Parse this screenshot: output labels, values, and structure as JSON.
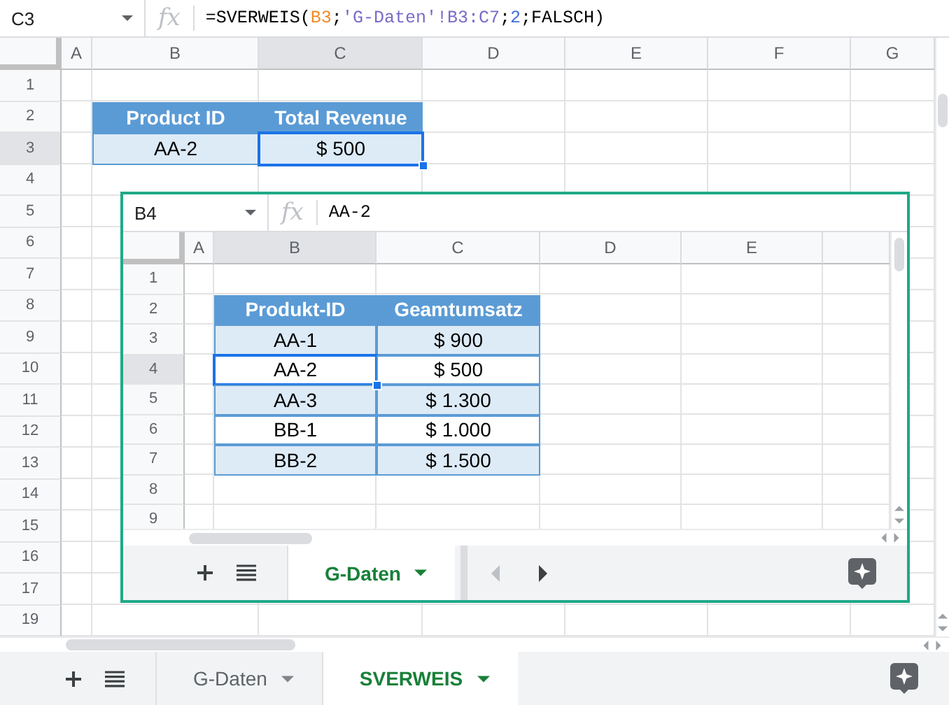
{
  "name_box": "C3",
  "fx_label": "fx",
  "formula": [
    {
      "text": "=SVERWEIS(",
      "color": "#000000"
    },
    {
      "text": "B3",
      "color": "#f28b2a"
    },
    {
      "text": ";",
      "color": "#000000"
    },
    {
      "text": "'G-Daten'!B3:C7",
      "color": "#7b6bc9"
    },
    {
      "text": ";",
      "color": "#000000"
    },
    {
      "text": "2",
      "color": "#3f6fd8"
    },
    {
      "text": ";FALSCH)",
      "color": "#000000"
    }
  ],
  "columns": [
    {
      "label": "A",
      "selected": false
    },
    {
      "label": "B",
      "selected": false
    },
    {
      "label": "C",
      "selected": true
    },
    {
      "label": "D",
      "selected": false
    },
    {
      "label": "E",
      "selected": false
    },
    {
      "label": "F",
      "selected": false
    },
    {
      "label": "G",
      "selected": false
    }
  ],
  "rows": [
    {
      "label": "1",
      "selected": false,
      "cells": []
    },
    {
      "label": "2",
      "selected": false,
      "cells": [
        {
          "text": "",
          "kind": "blank"
        },
        {
          "text": "Product ID",
          "kind": "header",
          "active": false
        },
        {
          "text": "Total Revenue",
          "kind": "header",
          "active": false
        }
      ]
    },
    {
      "label": "3",
      "selected": true,
      "cells": [
        {
          "text": "",
          "kind": "blank"
        },
        {
          "text": "AA-2",
          "kind": "data",
          "banded": true,
          "active": false
        },
        {
          "text": "$ 500",
          "kind": "data",
          "banded": true,
          "active": true
        }
      ]
    },
    {
      "label": "4",
      "selected": false,
      "cells": []
    },
    {
      "label": "5",
      "selected": false,
      "cells": []
    },
    {
      "label": "6",
      "selected": false,
      "cells": []
    },
    {
      "label": "7",
      "selected": false,
      "cells": []
    },
    {
      "label": "8",
      "selected": false,
      "cells": []
    },
    {
      "label": "9",
      "selected": false,
      "cells": []
    },
    {
      "label": "10",
      "selected": false,
      "cells": []
    },
    {
      "label": "11",
      "selected": false,
      "cells": []
    },
    {
      "label": "12",
      "selected": false,
      "cells": []
    },
    {
      "label": "13",
      "selected": false,
      "cells": []
    },
    {
      "label": "14",
      "selected": false,
      "cells": []
    },
    {
      "label": "15",
      "selected": false,
      "cells": []
    },
    {
      "label": "16",
      "selected": false,
      "cells": []
    },
    {
      "label": "17",
      "selected": false,
      "cells": []
    },
    {
      "label": "19",
      "selected": false,
      "cells": []
    }
  ],
  "sheet_tabs": [
    {
      "label": "G-Daten",
      "selected": false
    },
    {
      "label": "SVERWEIS",
      "selected": true
    }
  ],
  "embedded_screenshot": {
    "name_box": "B4",
    "fx_label": "fx",
    "formula": [
      {
        "text": "AA-2",
        "color": "#000000"
      }
    ],
    "columns": [
      {
        "label": "A",
        "selected": false
      },
      {
        "label": "B",
        "selected": true
      },
      {
        "label": "C",
        "selected": false
      },
      {
        "label": "D",
        "selected": false
      },
      {
        "label": "E",
        "selected": false
      }
    ],
    "rows": [
      {
        "label": "1",
        "selected": false,
        "cells": []
      },
      {
        "label": "2",
        "selected": false,
        "cells": [
          {
            "text": "",
            "kind": "blank"
          },
          {
            "text": "Produkt-ID",
            "kind": "header",
            "active": false
          },
          {
            "text": "Geamtumsatz",
            "kind": "header",
            "active": false
          }
        ]
      },
      {
        "label": "3",
        "selected": false,
        "cells": [
          {
            "text": "",
            "kind": "blank"
          },
          {
            "text": "AA-1",
            "kind": "data",
            "banded": true,
            "active": false
          },
          {
            "text": "$ 900",
            "kind": "data",
            "banded": true,
            "active": false
          }
        ]
      },
      {
        "label": "4",
        "selected": true,
        "cells": [
          {
            "text": "",
            "kind": "blank"
          },
          {
            "text": "AA-2",
            "kind": "data",
            "banded": false,
            "active": true
          },
          {
            "text": "$ 500",
            "kind": "data",
            "banded": false,
            "active": false
          }
        ]
      },
      {
        "label": "5",
        "selected": false,
        "cells": [
          {
            "text": "",
            "kind": "blank"
          },
          {
            "text": "AA-3",
            "kind": "data",
            "banded": true,
            "active": false
          },
          {
            "text": "$ 1.300",
            "kind": "data",
            "banded": true,
            "active": false
          }
        ]
      },
      {
        "label": "6",
        "selected": false,
        "cells": [
          {
            "text": "",
            "kind": "blank"
          },
          {
            "text": "BB-1",
            "kind": "data",
            "banded": false,
            "active": false
          },
          {
            "text": "$ 1.000",
            "kind": "data",
            "banded": false,
            "active": false
          }
        ]
      },
      {
        "label": "7",
        "selected": false,
        "cells": [
          {
            "text": "",
            "kind": "blank"
          },
          {
            "text": "BB-2",
            "kind": "data",
            "banded": true,
            "active": false
          },
          {
            "text": "$ 1.500",
            "kind": "data",
            "banded": true,
            "active": false
          }
        ]
      },
      {
        "label": "8",
        "selected": false,
        "cells": []
      },
      {
        "label": "9",
        "selected": false,
        "cells": []
      }
    ],
    "sheet_tabs": [
      {
        "label": "G-Daten",
        "selected": true
      }
    ]
  }
}
